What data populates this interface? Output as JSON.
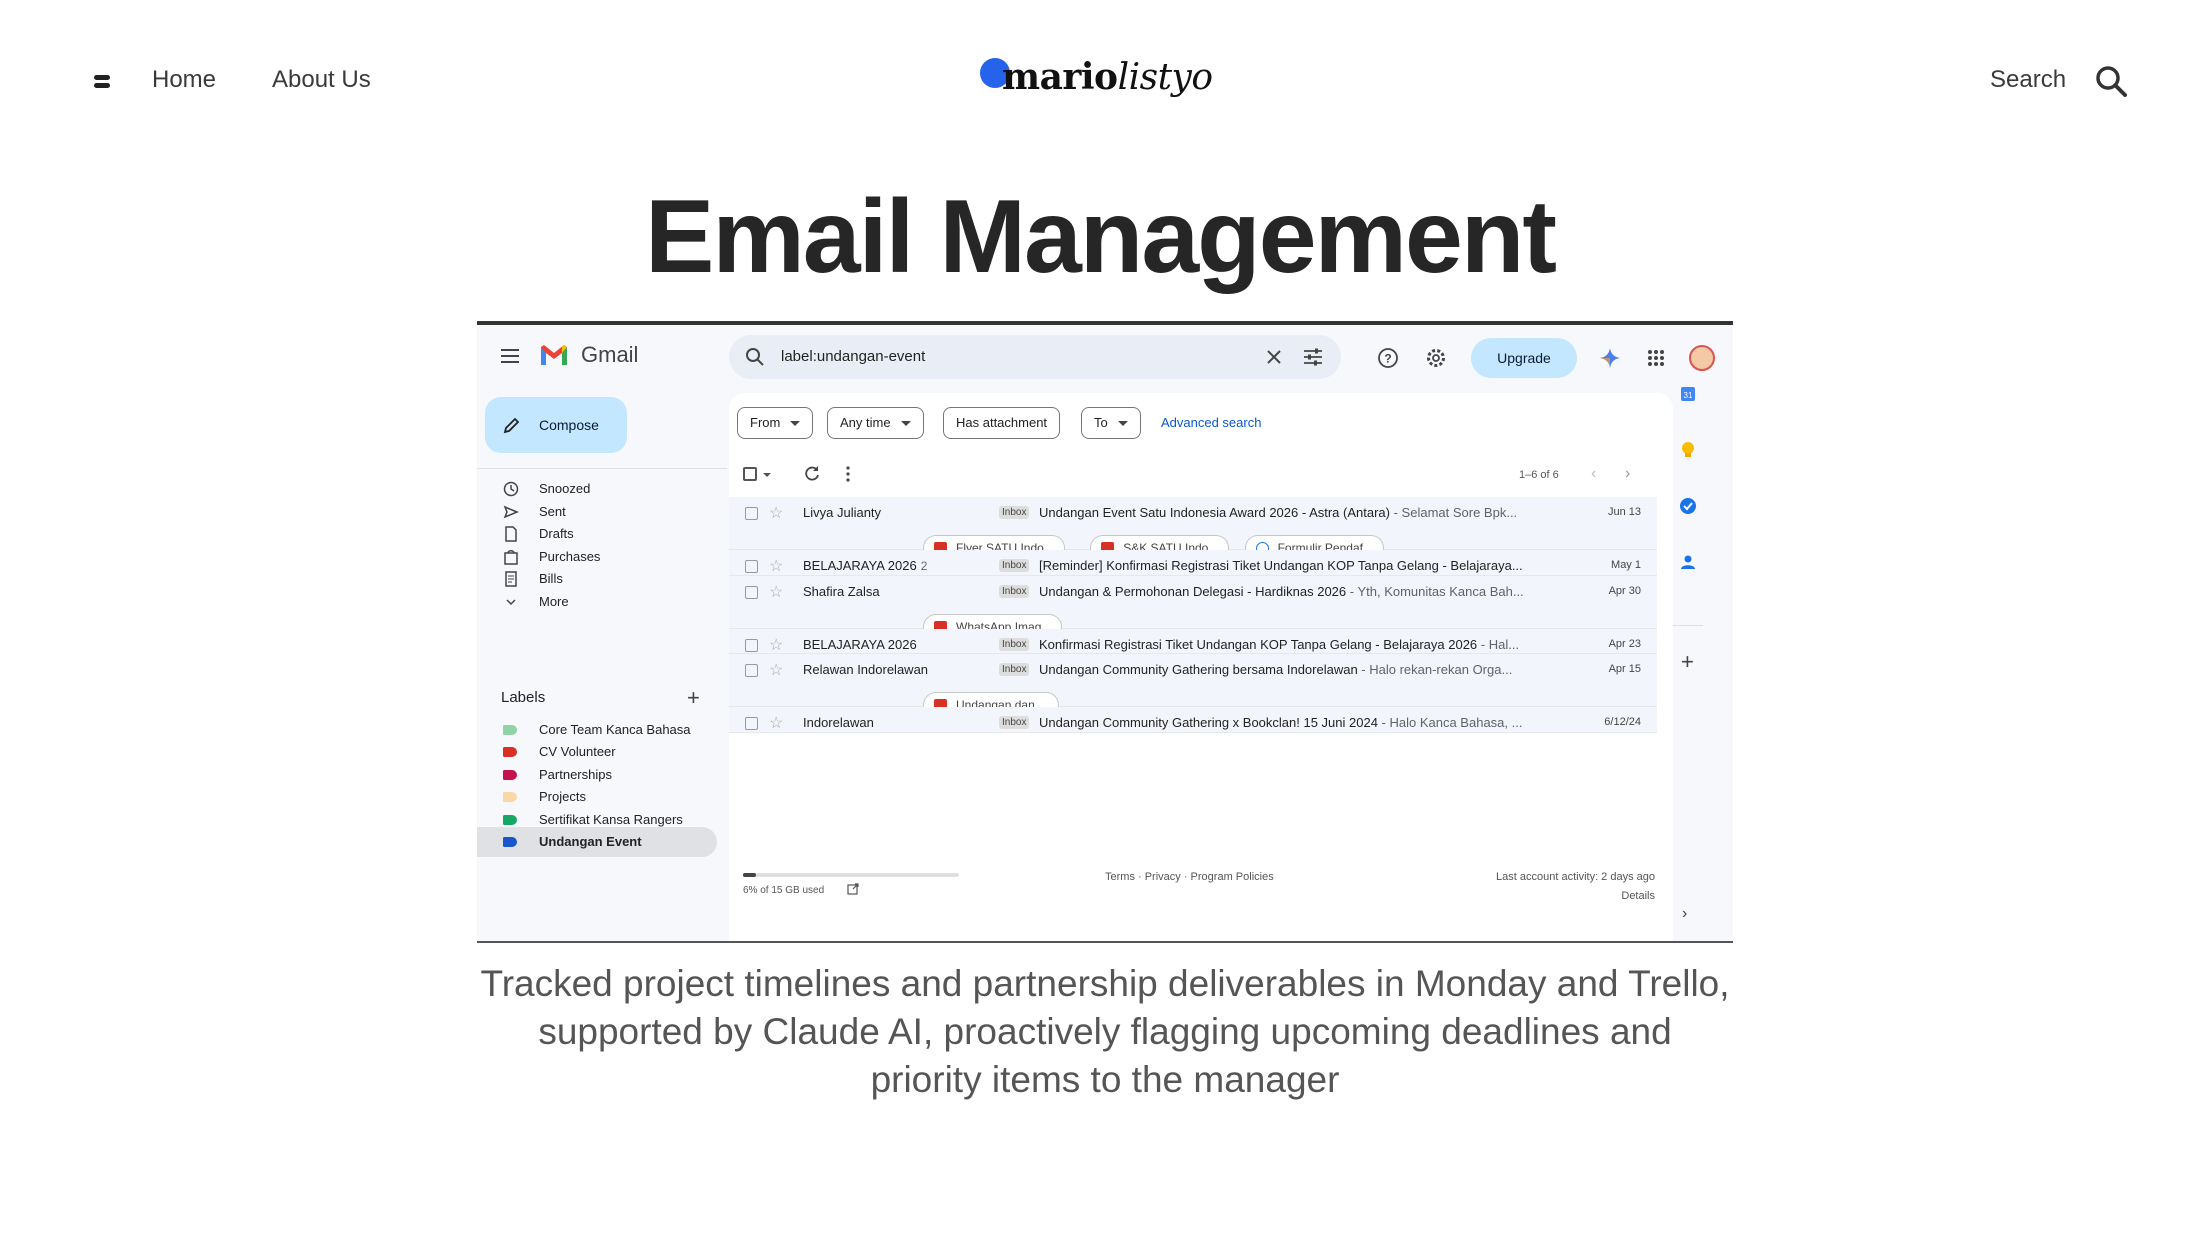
{
  "header": {
    "nav": {
      "home": "Home",
      "about": "About Us"
    },
    "logo": {
      "bold": "mario",
      "italic": "listyo"
    },
    "search_label": "Search"
  },
  "title": "Email Management",
  "caption": "Tracked project timelines and partnership deliverables in Monday and Trello, supported by Claude AI, proactively flagging upcoming deadlines and priority items to the manager",
  "gmail": {
    "app_name": "Gmail",
    "search_value": "label:undangan-event",
    "upgrade_label": "Upgrade",
    "compose_label": "Compose",
    "sidebar": [
      {
        "label": "Snoozed",
        "icon": "clock-icon"
      },
      {
        "label": "Sent",
        "icon": "send-icon"
      },
      {
        "label": "Drafts",
        "icon": "draft-icon"
      },
      {
        "label": "Purchases",
        "icon": "purchases-icon"
      },
      {
        "label": "Bills",
        "icon": "bills-icon"
      },
      {
        "label": "More",
        "icon": "chevron-down-icon"
      }
    ],
    "labels_heading": "Labels",
    "labels": [
      {
        "label": "Core Team Kanca Bahasa",
        "color": "#8fd3a7"
      },
      {
        "label": "CV Volunteer",
        "color": "#d93025"
      },
      {
        "label": "Partnerships",
        "color": "#c5124d"
      },
      {
        "label": "Projects",
        "color": "#fbd7a8"
      },
      {
        "label": "Sertifikat Kansa Rangers",
        "color": "#16a765"
      },
      {
        "label": "Undangan Event",
        "color": "#1a56c9",
        "active": true
      }
    ],
    "filters": {
      "from": "From",
      "any_time": "Any time",
      "has_attachment": "Has attachment",
      "to": "To",
      "advanced": "Advanced search"
    },
    "page_count": "1–6 of 6",
    "inbox_badge": "Inbox",
    "emails": [
      {
        "sender": "Livya Julianty",
        "count": "",
        "subject": "Undangan Event Satu Indonesia Award 2026 - Astra (Antara)",
        "snippet": " - Selamat Sore Bpk...",
        "date": "Jun 13",
        "attachments": [
          {
            "name": "Flyer SATU Indo...",
            "type": "img"
          },
          {
            "name": "S&K SATU Indo...",
            "type": "img"
          },
          {
            "name": "Formulir Pendaf...",
            "type": "doc"
          }
        ]
      },
      {
        "sender": "BELAJARAYA 2026",
        "count": "2",
        "subject": "[Reminder] Konfirmasi Registrasi Tiket Undangan KOP Tanpa Gelang - Belajaraya...",
        "snippet": "",
        "date": "May 1",
        "attachments": []
      },
      {
        "sender": "Shafira Zalsa",
        "count": "",
        "subject": "Undangan & Permohonan Delegasi - Hardiknas 2026",
        "snippet": " - Yth, Komunitas Kanca Bah...",
        "date": "Apr 30",
        "attachments": [
          {
            "name": "WhatsApp Imag...",
            "type": "img"
          }
        ]
      },
      {
        "sender": "BELAJARAYA 2026",
        "count": "",
        "subject": "Konfirmasi Registrasi Tiket Undangan KOP Tanpa Gelang - Belajaraya 2026",
        "snippet": " - Hal...",
        "date": "Apr 23",
        "attachments": []
      },
      {
        "sender": "Relawan Indorelawan",
        "count": "",
        "subject": "Undangan Community Gathering bersama Indorelawan",
        "snippet": " - Halo rekan-rekan Orga...",
        "date": "Apr 15",
        "attachments": [
          {
            "name": "Undangan dan ...",
            "type": "pdf"
          }
        ]
      },
      {
        "sender": "Indorelawan",
        "count": "",
        "subject": "Undangan Community Gathering x Bookclan! 15 Juni 2024",
        "snippet": " - Halo Kanca Bahasa, ...",
        "date": "6/12/24",
        "attachments": []
      }
    ],
    "storage_text": "6% of 15 GB used",
    "storage_fraction": 0.06,
    "footer_links": "Terms · Privacy · Program Policies",
    "last_activity": "Last account activity: 2 days ago",
    "details": "Details"
  }
}
